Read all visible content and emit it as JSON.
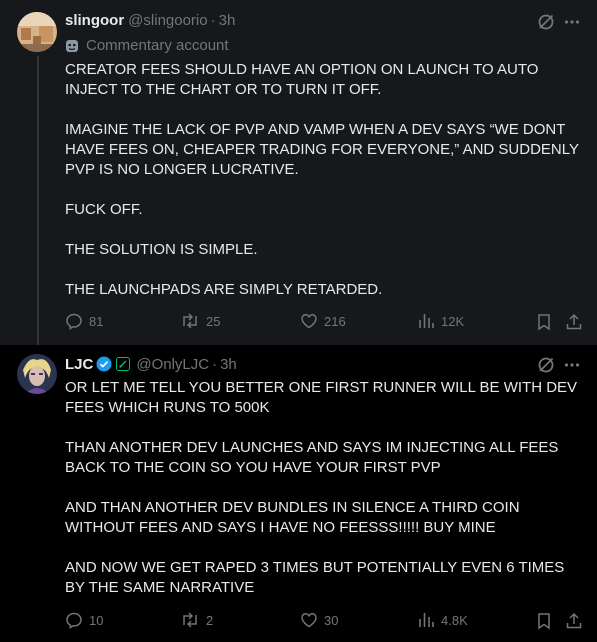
{
  "posts": [
    {
      "name": "slingoor",
      "handle": "@slingoorio",
      "separator": "·",
      "time": "3h",
      "label": "Commentary account",
      "paragraphs": [
        "CREATOR FEES SHOULD HAVE AN OPTION ON LAUNCH TO AUTO INJECT TO THE CHART OR TO TURN IT OFF.",
        "IMAGINE THE LACK OF PVP AND VAMP WHEN A DEV SAYS “WE DONT HAVE FEES ON, CHEAPER TRADING FOR EVERYONE,” AND SUDDENLY PVP IS NO LONGER LUCRATIVE.",
        "FUCK OFF.",
        "THE SOLUTION IS SIMPLE.",
        "THE LAUNCHPADS ARE SIMPLY RETARDED."
      ],
      "replies": "81",
      "reposts": "25",
      "likes": "216",
      "views": "12K"
    },
    {
      "name": "LJC",
      "handle": "@OnlyLJC",
      "separator": "·",
      "time": "3h",
      "paragraphs": [
        "OR LET ME TELL YOU BETTER ONE FIRST RUNNER WILL BE WITH DEV FEES WHICH RUNS TO 500K",
        "THAN ANOTHER DEV LAUNCHES AND SAYS IM INJECTING ALL FEES BACK TO THE COIN SO YOU HAVE YOUR FIRST PVP",
        "AND THAN ANOTHER DEV BUNDLES IN SILENCE A THIRD COIN WITHOUT FEES AND SAYS I HAVE NO FEESSS!!!!! BUY MINE",
        "AND NOW WE GET RAPED 3 TIMES BUT POTENTIALLY EVEN 6 TIMES BY THE SAME NARRATIVE"
      ],
      "replies": "10",
      "reposts": "2",
      "likes": "30",
      "views": "4.8K"
    }
  ],
  "colors": {
    "text": "#e7e9ea",
    "secondary": "#71767b",
    "verified": "#1d9bf0",
    "highlight_bg": "#16181c"
  },
  "icons": [
    "grok-icon",
    "more-icon",
    "reply-icon",
    "repost-icon",
    "like-icon",
    "views-icon",
    "bookmark-icon",
    "share-icon",
    "verified-badge-icon",
    "commentary-mask-icon"
  ]
}
